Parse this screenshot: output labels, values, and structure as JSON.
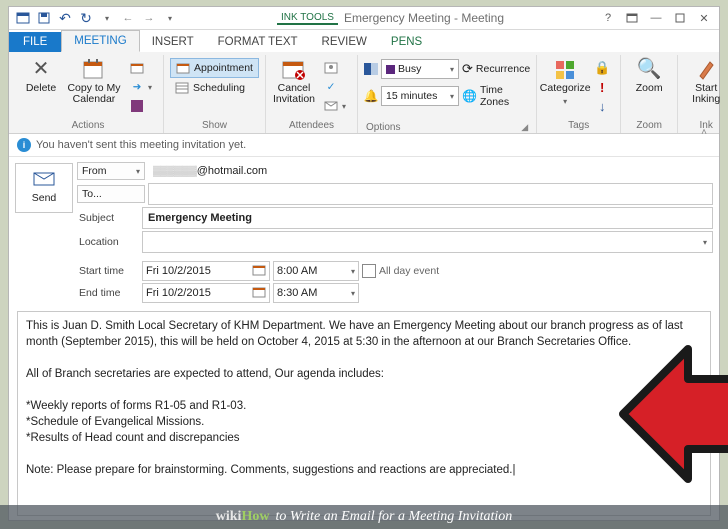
{
  "window": {
    "ink_tools": "INK TOOLS",
    "title": "Emergency Meeting - Meeting"
  },
  "tabs": {
    "file": "FILE",
    "meeting": "MEETING",
    "insert": "INSERT",
    "format": "FORMAT TEXT",
    "review": "REVIEW",
    "pens": "PENS"
  },
  "ribbon": {
    "actions": {
      "delete": "Delete",
      "copy": "Copy to My\nCalendar",
      "label": "Actions"
    },
    "show": {
      "appointment": "Appointment",
      "scheduling": "Scheduling",
      "label": "Show"
    },
    "attendees": {
      "cancel": "Cancel\nInvitation",
      "label": "Attendees"
    },
    "options": {
      "busy": "Busy",
      "reminder": "15 minutes",
      "recurrence": "Recurrence",
      "timezones": "Time Zones",
      "label": "Options"
    },
    "tags": {
      "categorize": "Categorize",
      "label": "Tags"
    },
    "zoom": {
      "zoom": "Zoom",
      "label": "Zoom"
    },
    "ink": {
      "start": "Start\nInking",
      "label": "Ink"
    }
  },
  "info": "You haven't sent this meeting invitation yet.",
  "compose": {
    "send": "Send",
    "from_label": "From",
    "from_value": "@hotmail.com",
    "to_label": "To...",
    "subject_label": "Subject",
    "subject": "Emergency Meeting",
    "location_label": "Location",
    "start_label": "Start time",
    "start_date": "Fri 10/2/2015",
    "start_time": "8:00 AM",
    "end_label": "End time",
    "end_date": "Fri 10/2/2015",
    "end_time": "8:30 AM",
    "allday": "All day event"
  },
  "body": "This is Juan D. Smith Local Secretary of KHM Department. We have an Emergency Meeting about our branch progress as of last month (September 2015), this will be held on October 4, 2015 at 5:30 in the afternoon at our Branch Secretaries Office.\n\nAll of Branch secretaries are expected to attend, Our agenda includes:\n\n*Weekly reports of forms R1-05 and R1-03.\n*Schedule of Evangelical Missions.\n*Results of Head count and discrepancies\n\nNote: Please prepare for brainstorming. Comments, suggestions and reactions are appreciated.|",
  "footer": {
    "brand1": "wiki",
    "brand2": "How",
    "title": "to Write an Email for a Meeting Invitation"
  }
}
